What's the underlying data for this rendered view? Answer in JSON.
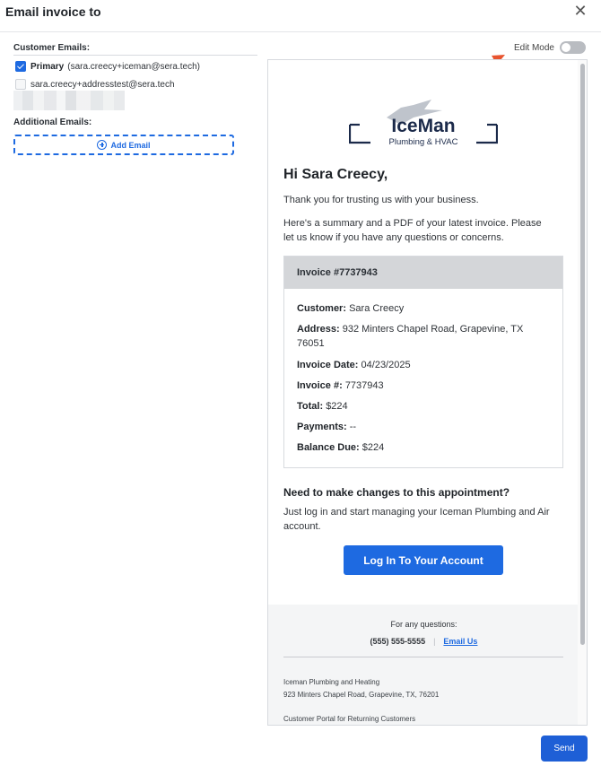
{
  "dialog": {
    "title": "Email invoice to",
    "close_icon": "close-icon",
    "send_label": "Send"
  },
  "recipients": {
    "customer_emails_label": "Customer Emails:",
    "primary_label": "Primary",
    "primary_email": "(sara.creecy+iceman@sera.tech)",
    "primary_checked": true,
    "secondary_email": "sara.creecy+addresstest@sera.tech",
    "secondary_checked": false,
    "additional_emails_label": "Additional Emails:",
    "add_email_label": "Add Email"
  },
  "edit_mode": {
    "label": "Edit Mode",
    "enabled": false
  },
  "email_preview": {
    "logo": {
      "brand": "IceMan",
      "tagline": "Plumbing & HVAC"
    },
    "greeting": "Hi Sara Creecy,",
    "thanks": "Thank you for trusting us with your business.",
    "summary": "Here's a summary and a PDF of your latest invoice. Please let us know if you have any questions or concerns.",
    "invoice": {
      "heading": "Invoice #7737943",
      "customer_label": "Customer:",
      "customer": "Sara Creecy",
      "address_label": "Address:",
      "address": "932 Minters Chapel Road, Grapevine, TX 76051",
      "date_label": "Invoice Date:",
      "date": "04/23/2025",
      "number_label": "Invoice #:",
      "number": "7737943",
      "total_label": "Total:",
      "total": "$224",
      "payments_label": "Payments:",
      "payments": "--",
      "balance_label": "Balance Due:",
      "balance": "$224"
    },
    "changes_title": "Need to make changes to this appointment?",
    "changes_text": "Just log in and start managing your Iceman Plumbing and Air account.",
    "login_button": "Log In To Your Account",
    "footer": {
      "questions": "For any questions:",
      "phone": "(555) 555-5555",
      "separator": "|",
      "email_link": "Email Us",
      "company": "Iceman Plumbing and Heating",
      "company_address": "923 Minters Chapel Road, Grapevine, TX, 76201",
      "portal": "Customer Portal for Returning Customers"
    }
  },
  "colors": {
    "accent": "#1e6ae1",
    "annotation_arrow": "#e8542f",
    "invoice_header_bg": "#d4d6d9",
    "footer_bg": "#f4f5f6",
    "logo_navy": "#1b2a4a"
  }
}
